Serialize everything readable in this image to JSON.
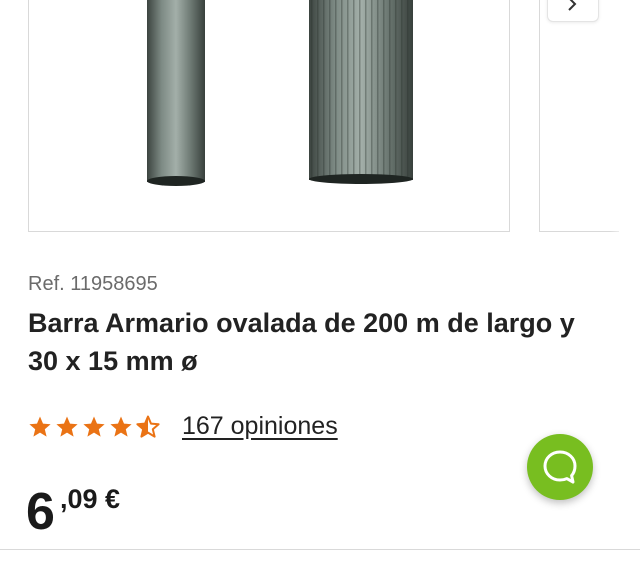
{
  "product": {
    "reference": "Ref. 11958695",
    "title": "Barra Armario ovalada de 200 m de largo y 30 x 15 mm ø",
    "rating": {
      "value": 4.5,
      "max": 5,
      "reviews_label": "167 opiniones"
    },
    "price": {
      "integer": "6",
      "decimal": ",09 €"
    }
  },
  "gallery": {
    "next_icon": "chevron-right-icon",
    "image_alt_names": [
      "rail-profile-narrow",
      "rail-profile-ribbed"
    ]
  },
  "chat": {
    "icon": "chat-bubble-icon"
  },
  "colors": {
    "accent": "#78be20",
    "star": "#ea7315"
  }
}
